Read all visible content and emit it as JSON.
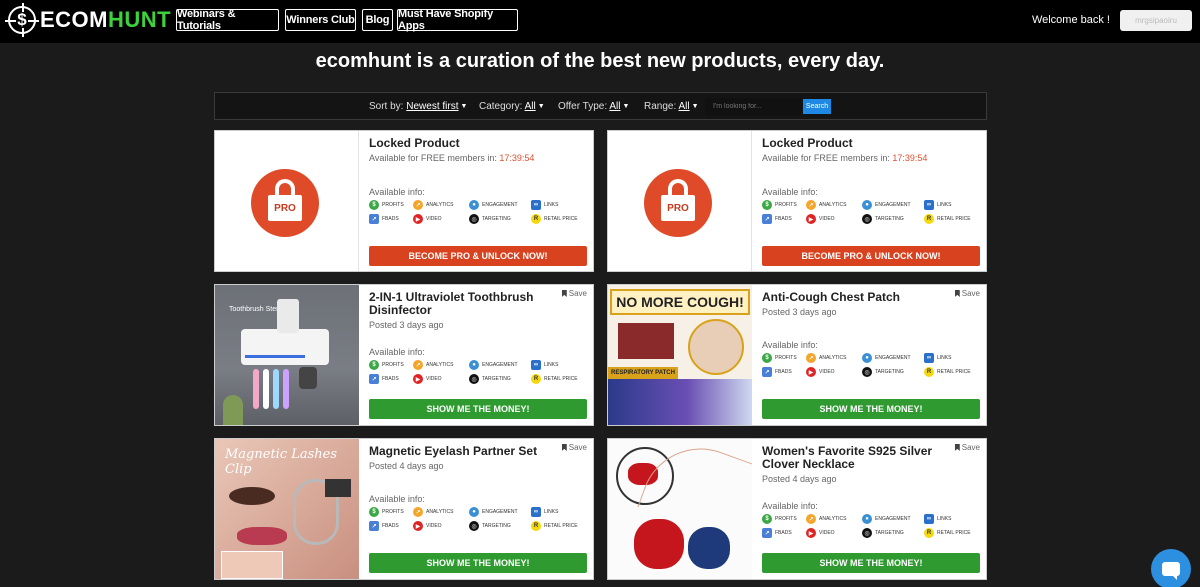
{
  "brand": {
    "logo_symbol": "$",
    "logo_text_a": "ECOM",
    "logo_text_b": "HUNT",
    "accent": "#3dd13d"
  },
  "nav": {
    "items": [
      {
        "label": "Webinars & Tutorials"
      },
      {
        "label": "Winners Club"
      },
      {
        "label": "Blog"
      },
      {
        "label": "Must Have Shopify Apps"
      }
    ],
    "welcome": "Welcome back !",
    "user_name": "mrgsipaoiru"
  },
  "headline": "ecomhunt is a curation of the best new products, every day.",
  "filters": {
    "sort_label": "Sort by:",
    "sort_value": "Newest first",
    "category_label": "Category:",
    "category_value": "All",
    "offer_label": "Offer Type:",
    "offer_value": "All",
    "range_label": "Range:",
    "range_value": "All",
    "search_placeholder": "I'm looking for...",
    "search_button": "Search"
  },
  "tags": {
    "profits": "PROFITS",
    "analytics": "ANALYTICS",
    "engagement": "ENGAGEMENT",
    "links": "LINKS",
    "fbads": "FBADS",
    "video": "VIDEO",
    "targeting": "TARGETING",
    "retail": "RETAIL PRICE"
  },
  "available_info": "Available info:",
  "save_label": "Save",
  "locked_cards": [
    {
      "title": "Locked Product",
      "subtitle": "Available for FREE members in:",
      "timer": "17:39:54",
      "badge": "PRO",
      "cta": "BECOME PRO & UNLOCK NOW!"
    },
    {
      "title": "Locked Product",
      "subtitle": "Available for FREE members in:",
      "timer": "17:39:54",
      "badge": "PRO",
      "cta": "BECOME PRO & UNLOCK NOW!"
    }
  ],
  "products": [
    {
      "title": "2-IN-1 Ultraviolet Toothbrush Disinfector",
      "posted": "Posted 3 days ago",
      "cta": "SHOW ME THE MONEY!",
      "image_text": "Toothbrush Sterilizer"
    },
    {
      "title": "Anti-Cough Chest Patch",
      "posted": "Posted 3 days ago",
      "cta": "SHOW ME THE MONEY!",
      "image_text": "NO MORE COUGH!",
      "image_text2": "RESPIRATORY PATCH"
    },
    {
      "title": "Magnetic Eyelash Partner Set",
      "posted": "Posted 4 days ago",
      "cta": "SHOW ME THE MONEY!",
      "image_text": "Magnetic Lashes Clip"
    },
    {
      "title": "Women's Favorite S925 Silver Clover Necklace",
      "posted": "Posted 4 days ago",
      "cta": "SHOW ME THE MONEY!"
    }
  ],
  "colors": {
    "cta_red": "#d9421f",
    "cta_green": "#2e9a30",
    "timer": "#e05030",
    "chat": "#2c8fe0"
  }
}
